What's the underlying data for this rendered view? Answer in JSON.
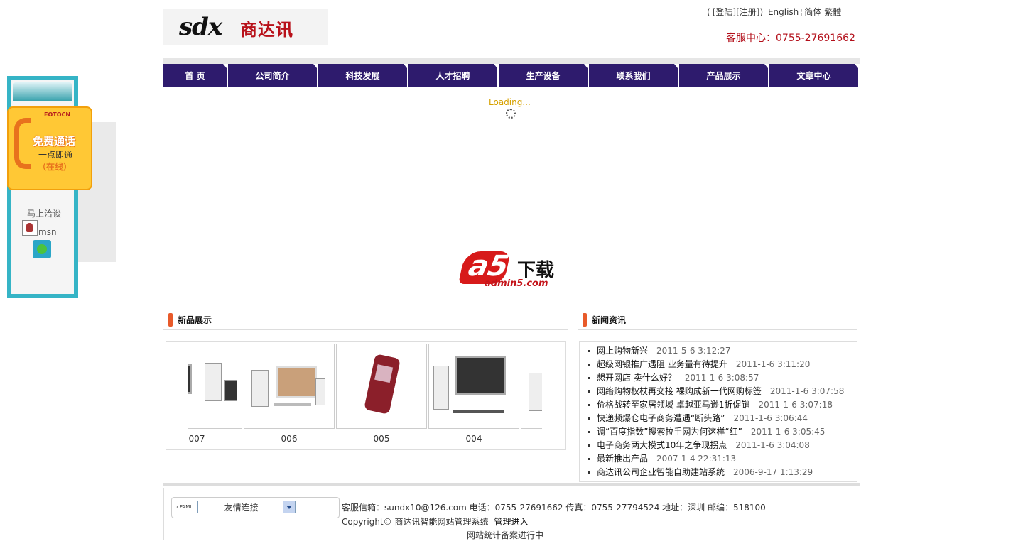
{
  "header": {
    "logo_latin": "sdx",
    "logo_cn": "商达讯",
    "login": "[登陆]",
    "register": "[注册]",
    "english": "English",
    "simplified": "简体",
    "traditional": "繁體",
    "open_paren": "(",
    "close_paren": ")",
    "hotline": "客服中心：0755-27691662"
  },
  "nav": [
    {
      "label": "首  页"
    },
    {
      "label": "公司简介"
    },
    {
      "label": "科技发展"
    },
    {
      "label": "人才招聘"
    },
    {
      "label": "生产设备"
    },
    {
      "label": "联系我们"
    },
    {
      "label": "产品展示"
    },
    {
      "label": "文章中心"
    }
  ],
  "loading": "Loading...",
  "banner": {
    "download": "下载",
    "url": "admin5.com",
    "letters": "a5"
  },
  "products_section": {
    "title": "新品展示",
    "items": [
      {
        "caption": "007"
      },
      {
        "caption": "006"
      },
      {
        "caption": "005"
      },
      {
        "caption": "004"
      },
      {
        "caption": ""
      }
    ]
  },
  "news_section": {
    "title": "新闻资讯",
    "items": [
      {
        "title": "网上购物新兴",
        "date": "2011-5-6 3:12:27"
      },
      {
        "title": "超级网银推广遇阻 业务量有待提升",
        "date": "2011-1-6 3:11:20"
      },
      {
        "title": "想开网店 卖什么好？",
        "date": "2011-1-6 3:08:57"
      },
      {
        "title": "网络购物权杖再交接 裸购成新一代网购标签",
        "date": "2011-1-6 3:07:58"
      },
      {
        "title": "价格战转至家居领域 卓越亚马逊1折促销",
        "date": "2011-1-6 3:07:18"
      },
      {
        "title": "快递频爆仓电子商务遭遇“断头路”",
        "date": "2011-1-6 3:06:44"
      },
      {
        "title": "调“百度指数”搜索拉手网为何这样“红”",
        "date": "2011-1-6 3:05:45"
      },
      {
        "title": "电子商务两大模式10年之争现拐点",
        "date": "2011-1-6 3:04:08"
      },
      {
        "title": "最新推出产品",
        "date": "2007-1-4 22:31:13"
      },
      {
        "title": "商达讯公司企业智能自助建站系统",
        "date": "2006-9-17 1:13:29"
      }
    ]
  },
  "footer": {
    "friend_prefix": "› FAMI",
    "friend_select": "--------友情连接--------",
    "info": "客服信箱：sundx10@126.com 电话：0755-27691662 传真：0755-27794524 地址：深圳 邮编：518100",
    "copyright": "Copyright© 商达讯智能网站管理系统",
    "admin": "管理进入",
    "stats": "网站统计",
    "icp": "备案进行中"
  },
  "float_widget": {
    "brand": "EOTOCN",
    "free_call": "免费通话",
    "one_click": "一点即通",
    "online": "（在线）",
    "talk": "马上洽谈",
    "msn": "msn"
  }
}
